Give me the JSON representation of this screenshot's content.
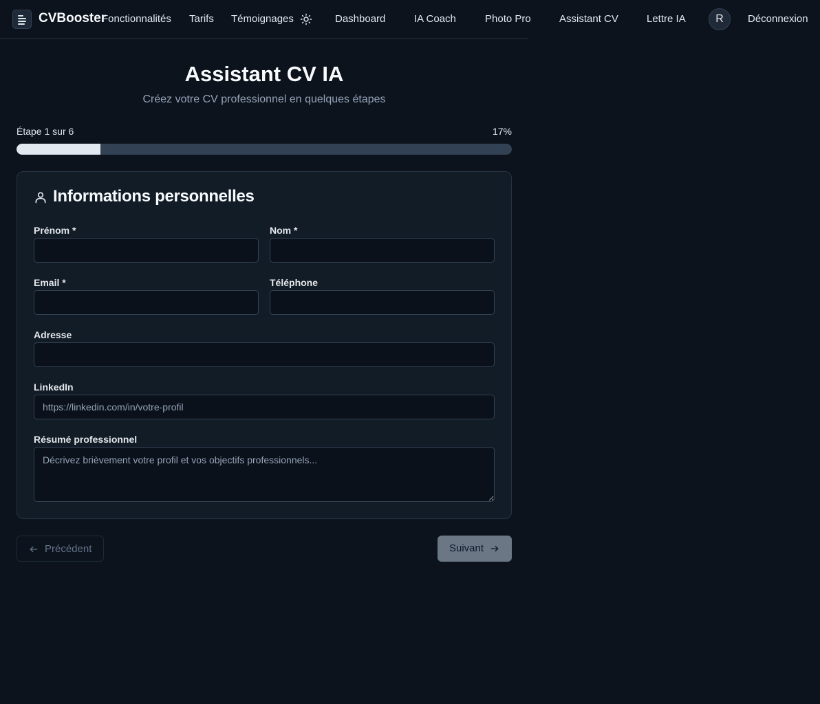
{
  "brand": {
    "name": "CVBooster",
    "logo_icon": "document-icon"
  },
  "nav": {
    "features": "Fonctionnalités",
    "pricing": "Tarifs",
    "testimonials": "Témoignages",
    "theme_icon": "sun-icon",
    "dashboard": "Dashboard",
    "coach": "IA Coach",
    "photo": "Photo Pro",
    "cv_assistant": "Assistant CV",
    "letter": "Lettre IA",
    "avatar_initial": "R",
    "logout": "Déconnexion"
  },
  "header": {
    "title": "Assistant CV IA",
    "subtitle": "Créez votre CV professionnel en quelques étapes"
  },
  "progress": {
    "step_label": "Étape 1 sur 6",
    "percent_label": "17%",
    "percent_value": 17
  },
  "form": {
    "section_title": "Informations personnelles",
    "section_icon": "user-icon",
    "fields": {
      "first_name": {
        "label": "Prénom *",
        "value": "",
        "placeholder": ""
      },
      "last_name": {
        "label": "Nom *",
        "value": "",
        "placeholder": ""
      },
      "email": {
        "label": "Email *",
        "value": "",
        "placeholder": ""
      },
      "phone": {
        "label": "Téléphone",
        "value": "",
        "placeholder": ""
      },
      "address": {
        "label": "Adresse",
        "value": "",
        "placeholder": ""
      },
      "linkedin": {
        "label": "LinkedIn",
        "value": "",
        "placeholder": "https://linkedin.com/in/votre-profil"
      },
      "summary": {
        "label": "Résumé professionnel",
        "value": "",
        "placeholder": "Décrivez brièvement votre profil et vos objectifs professionnels..."
      }
    }
  },
  "actions": {
    "previous": "Précédent",
    "next": "Suivant"
  },
  "colors": {
    "background": "#0c131c",
    "card": "#111c26",
    "progress_fill": "#e2e8f0",
    "next_button": "#6b7785"
  }
}
